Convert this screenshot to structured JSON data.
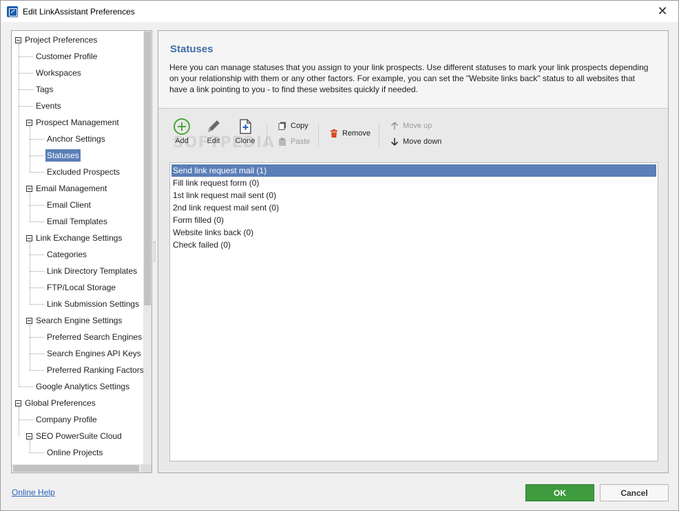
{
  "window": {
    "title": "Edit LinkAssistant Preferences"
  },
  "tree": {
    "items": [
      {
        "label": "Project Preferences",
        "level": 0,
        "expanded": true
      },
      {
        "label": "Customer Profile",
        "level": 1
      },
      {
        "label": "Workspaces",
        "level": 1
      },
      {
        "label": "Tags",
        "level": 1
      },
      {
        "label": "Events",
        "level": 1
      },
      {
        "label": "Prospect Management",
        "level": 1,
        "expanded": true
      },
      {
        "label": "Anchor Settings",
        "level": 2
      },
      {
        "label": "Statuses",
        "level": 2,
        "selected": true
      },
      {
        "label": "Excluded Prospects",
        "level": 2
      },
      {
        "label": "Email Management",
        "level": 1,
        "expanded": true
      },
      {
        "label": "Email Client",
        "level": 2
      },
      {
        "label": "Email Templates",
        "level": 2
      },
      {
        "label": "Link Exchange Settings",
        "level": 1,
        "expanded": true
      },
      {
        "label": "Categories",
        "level": 2
      },
      {
        "label": "Link Directory Templates",
        "level": 2
      },
      {
        "label": "FTP/Local Storage",
        "level": 2
      },
      {
        "label": "Link Submission Settings",
        "level": 2
      },
      {
        "label": "Search Engine Settings",
        "level": 1,
        "expanded": true
      },
      {
        "label": "Preferred Search Engines",
        "level": 2
      },
      {
        "label": "Search Engines API Keys",
        "level": 2
      },
      {
        "label": "Preferred Ranking Factors",
        "level": 2
      },
      {
        "label": "Google Analytics Settings",
        "level": 1
      },
      {
        "label": "Global Preferences",
        "level": 0,
        "expanded": true
      },
      {
        "label": "Company Profile",
        "level": 1
      },
      {
        "label": "SEO PowerSuite Cloud",
        "level": 1,
        "expanded": true
      },
      {
        "label": "Online Projects",
        "level": 2
      }
    ]
  },
  "main": {
    "title": "Statuses",
    "description": "Here you can manage statuses that you assign to your link prospects. Use different statuses to mark your link prospects depending on your relationship with them or any other factors. For example, you can set the \"Website links back\" status to all websites that have a link pointing to you - to find these websites quickly if needed.",
    "toolbar": {
      "add": "Add",
      "edit": "Edit",
      "clone": "Clone",
      "copy": "Copy",
      "paste": "Paste",
      "remove": "Remove",
      "move_up": "Move up",
      "move_down": "Move down"
    },
    "statuses": [
      {
        "label": "Send link request mail (1)",
        "selected": true
      },
      {
        "label": "Fill link request form (0)"
      },
      {
        "label": "1st link request mail sent (0)"
      },
      {
        "label": "2nd link request mail sent (0)"
      },
      {
        "label": "Form filled (0)"
      },
      {
        "label": "Website links back (0)"
      },
      {
        "label": "Check failed (0)"
      }
    ],
    "watermark": "SOFTPEDIA"
  },
  "footer": {
    "help": "Online Help",
    "ok": "OK",
    "cancel": "Cancel"
  },
  "colors": {
    "accent": "#5b7fb7",
    "title": "#3f6ea8",
    "ok_button": "#3e9b3e",
    "link": "#2a62b8",
    "add_icon": "#4aa63a",
    "remove_icon": "#d14b1e"
  }
}
